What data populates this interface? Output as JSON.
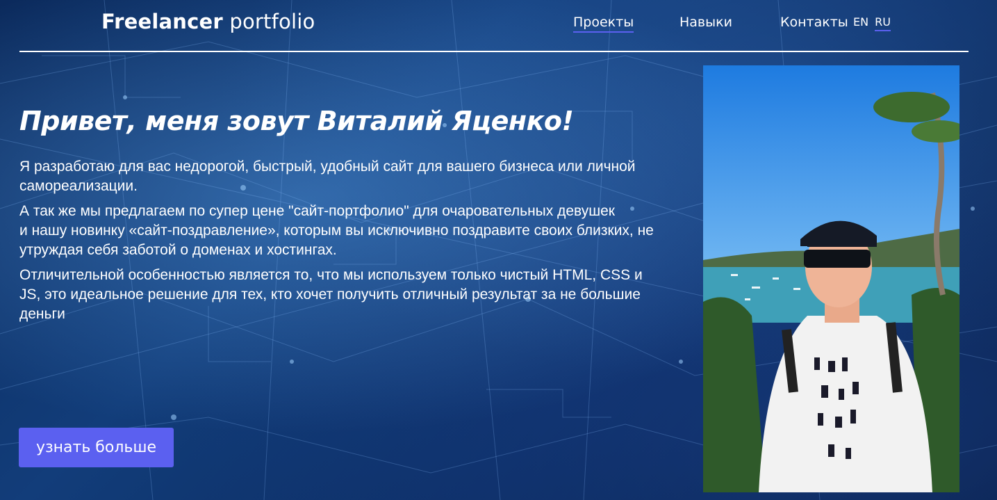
{
  "header": {
    "logo_bold": "Freelancer",
    "logo_light": "portfolio",
    "nav": [
      "Проекты",
      "Навыки",
      "Контакты"
    ],
    "lang": [
      "EN",
      "RU"
    ]
  },
  "hero": {
    "title": "Привет, меня зовут Виталий Яценко!",
    "paragraphs": [
      "Я разработаю для вас недорогой, быстрый, удобный сайт для вашего бизнеса или личной самореализации.",
      "А так же мы предлагаем по супер цене \"сайт-портфолио\" для очаровательных девушек",
      "и нашу новинку «сайт-поздравление», которым вы исключивно поздравите своих близких, не утруждая себя заботой о доменах и хостингах.",
      "Отличительной особенностью является то, что мы используем только чистый HTML, CSS и JS, это идеальное решение для тех, кто хочет получить отличный результат за не большие деньги"
    ],
    "button_label": "узнать больше"
  },
  "colors": {
    "accent": "#5b60f0",
    "background": "#0b2a5c",
    "text": "#ffffff"
  }
}
